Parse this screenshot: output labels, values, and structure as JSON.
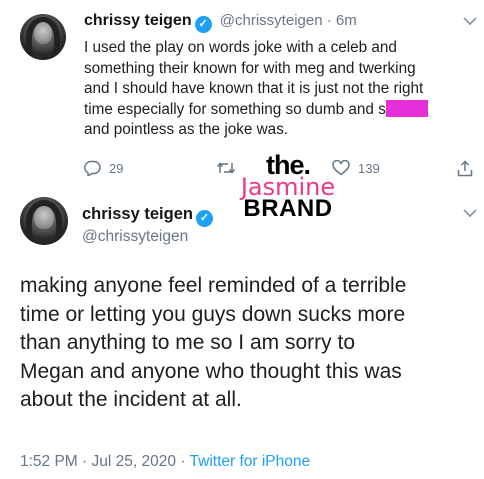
{
  "tweet1": {
    "name": "chrissy teigen",
    "handle": "@chrissyteigen",
    "separator": "·",
    "time": "6m",
    "lines": [
      "I used the play on words joke with a celeb and",
      "something their known for with meg and twerking",
      "and I should have known that it is just not the right",
      "time especially for something so dumb and s",
      "and pointless as the joke was."
    ],
    "replies": "29",
    "likes": "139",
    "redaction_color": "#e62fd8"
  },
  "watermark": {
    "line1": "the.",
    "line2": "Jasmine",
    "line3": "BRAND"
  },
  "tweet2": {
    "name": "chrissy teigen",
    "handle": "@chrissyteigen",
    "lines": [
      "making anyone feel reminded of a terrible",
      "time or letting you guys down sucks more",
      "than anything to me so I am sorry to",
      "Megan and anyone who thought this was",
      "about the incident at all."
    ],
    "time": "1:52 PM",
    "separator": "·",
    "date": "Jul 25, 2020",
    "source": "Twitter for iPhone"
  },
  "colors": {
    "accent": "#1da1f2",
    "muted": "#657786",
    "watermark_pink": "#e8398a"
  }
}
